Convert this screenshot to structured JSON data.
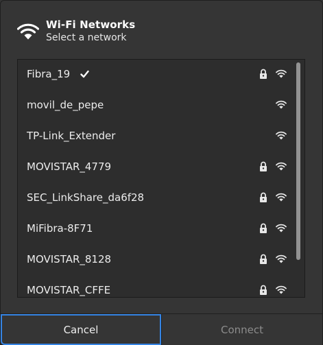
{
  "header": {
    "icon": "wifi-icon",
    "title": "Wi-Fi Networks",
    "subtitle": "Select a network"
  },
  "networks": [
    {
      "name": "Fibra_19",
      "connected": true,
      "secured": true,
      "signal": "wifi-signal-icon"
    },
    {
      "name": "movil_de_pepe",
      "connected": false,
      "secured": false,
      "signal": "wifi-signal-icon"
    },
    {
      "name": "TP-Link_Extender",
      "connected": false,
      "secured": false,
      "signal": "wifi-signal-icon"
    },
    {
      "name": "MOVISTAR_4779",
      "connected": false,
      "secured": true,
      "signal": "wifi-signal-icon"
    },
    {
      "name": "SEC_LinkShare_da6f28",
      "connected": false,
      "secured": true,
      "signal": "wifi-signal-icon"
    },
    {
      "name": "MiFibra-8F71",
      "connected": false,
      "secured": true,
      "signal": "wifi-signal-icon"
    },
    {
      "name": "MOVISTAR_8128",
      "connected": false,
      "secured": true,
      "signal": "wifi-signal-icon"
    },
    {
      "name": "MOVISTAR_CFFE",
      "connected": false,
      "secured": true,
      "signal": "wifi-signal-icon"
    }
  ],
  "footer": {
    "cancel_label": "Cancel",
    "connect_label": "Connect"
  },
  "colors": {
    "background": "#353535",
    "list_background": "#2d2d2d",
    "focus_accent": "#3584e4",
    "text": "#ececec",
    "disabled_text": "#8c8c8c"
  }
}
